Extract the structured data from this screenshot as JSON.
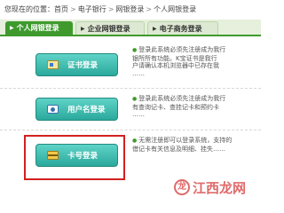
{
  "breadcrumb": {
    "prefix": "您现在的位置：",
    "items": [
      "首页",
      "电子银行",
      "网银登录",
      "个人网银登录"
    ],
    "separator": ">"
  },
  "tabs": [
    {
      "label": "个人网银登录",
      "active": true
    },
    {
      "label": "企业网银登录",
      "active": false
    },
    {
      "label": "电子商务登录",
      "active": false
    }
  ],
  "login_options": [
    {
      "label": "证书登录",
      "icon": "certificate-icon",
      "desc": [
        "登录此系统必须先注册成为我行",
        "银所所有功能。K宝证书是我行",
        "户请确认本机浏览器中已存在我",
        "……"
      ]
    },
    {
      "label": "用户名登录",
      "icon": "user-icon",
      "desc": [
        "登录此系统必须先注册成为我行",
        "有查询记卡、查挂记卡和预约卡",
        "……"
      ]
    },
    {
      "label": "卡号登录",
      "icon": "card-icon",
      "desc": [
        "无需注册即可以登录系统，支持的",
        "借记卡有关信息及明细、挂失……"
      ]
    }
  ],
  "watermark": {
    "text": "江西龙网",
    "logo": "龙"
  },
  "colors": {
    "accent_green": "#3f9a2e",
    "button_teal": "#2aa99c",
    "highlight_red": "#d2211f"
  }
}
